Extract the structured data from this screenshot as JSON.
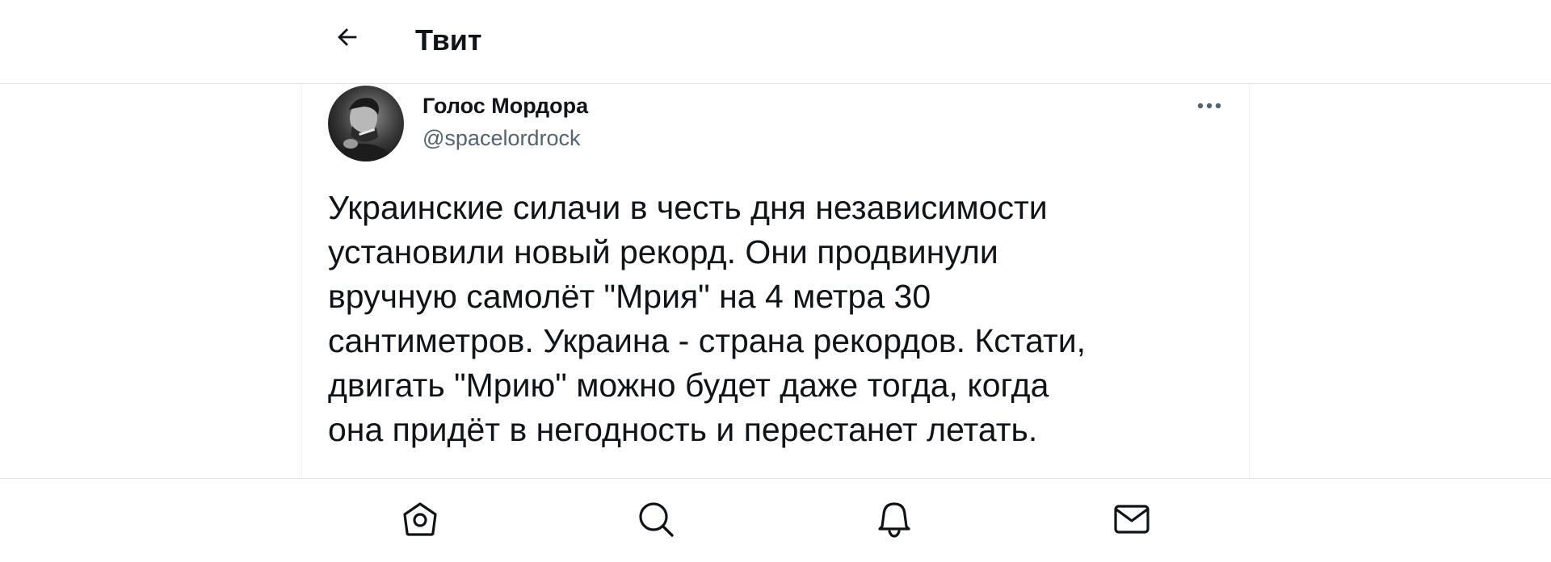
{
  "header": {
    "title": "Твит",
    "back_icon": "arrow-left-icon"
  },
  "tweet": {
    "author": {
      "display_name": "Голос Мордора",
      "handle": "@spacelordrock",
      "avatar": "avatar-photo"
    },
    "more_icon": "more-horizontal-icon",
    "text": "Украинские силачи в честь дня независимости\nустановили новый рекорд. Они продвинули\nвручную самолёт \"Мрия\" на 4 метра 30\nсантиметров. Украина - страна рекордов. Кстати,\nдвигать \"Мрию\" можно будет даже тогда, когда\nона придёт в негодность и перестанет летать."
  },
  "bottom_nav": {
    "items": [
      {
        "icon": "home-icon"
      },
      {
        "icon": "search-icon"
      },
      {
        "icon": "bell-icon"
      },
      {
        "icon": "mail-icon"
      }
    ]
  },
  "colors": {
    "text_primary": "#0f1419",
    "text_secondary": "#536471",
    "divider": "#e1e6ea"
  }
}
